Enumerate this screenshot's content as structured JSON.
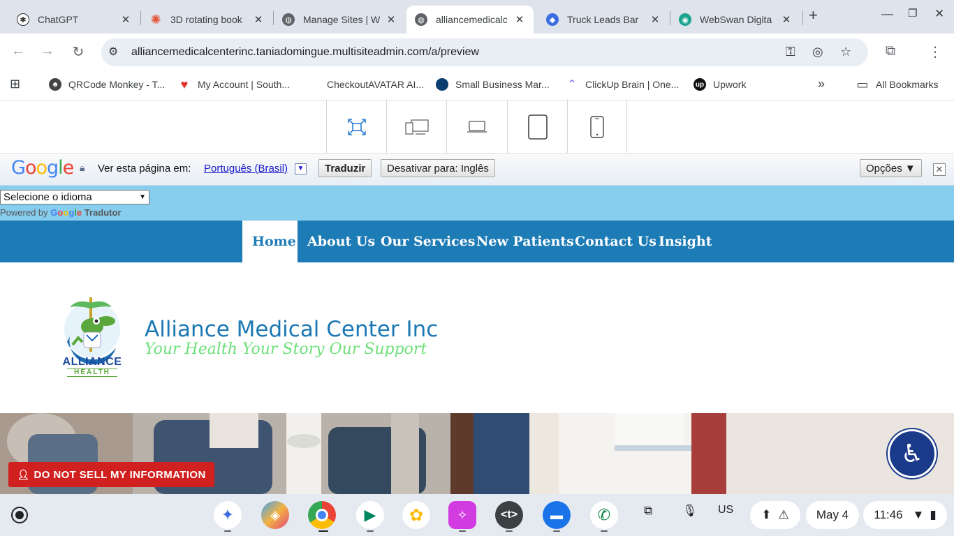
{
  "browser": {
    "tabs": [
      {
        "label": "ChatGPT",
        "icon": "chatgpt-icon"
      },
      {
        "label": "3D rotating book",
        "icon": "sparkle-icon"
      },
      {
        "label": "Manage Sites | W",
        "icon": "globe-icon"
      },
      {
        "label": "alliancemedicalc",
        "icon": "globe-icon",
        "active": true
      },
      {
        "label": "Truck Leads Bar",
        "icon": "dialog-icon"
      },
      {
        "label": "WebSwan Digita",
        "icon": "webswan-icon"
      }
    ],
    "new_tab": "+",
    "url": "alliancemedicalcenterinc.taniadomingue.multisiteadmin.com/a/preview",
    "bookmarks": [
      {
        "label": "QRCode Monkey - T...",
        "icon": "monkey-icon"
      },
      {
        "label": "My Account | South...",
        "icon": "heart-icon"
      },
      {
        "label": "CheckoutAVATAR AI...",
        "icon": "apple-icon"
      },
      {
        "label": "Small Business Mar...",
        "icon": "circle-icon"
      },
      {
        "label": "ClickUp Brain | One...",
        "icon": "clickup-icon"
      },
      {
        "label": "Upwork",
        "icon": "upwork-icon"
      }
    ],
    "bookmarks_overflow": "»",
    "all_bookmarks": "All Bookmarks"
  },
  "translate_bar": {
    "brand": "Google",
    "prompt": "Ver esta página em:",
    "language_link": "Português (Brasil)",
    "language_arrow": "▼",
    "translate_button": "Traduzir",
    "disable_button": "Desativar para: Inglês",
    "options_button": "Opções ▼",
    "close": "✕"
  },
  "page": {
    "language_select": "Selecione o idioma",
    "powered_by": "Powered by",
    "powered_google": "Google",
    "powered_tradutor": "Tradutor",
    "nav": [
      "Home",
      "About Us",
      "Our Services",
      "New Patients",
      "Contact Us",
      "Insight"
    ],
    "logo_text": "ALLIANCE",
    "logo_sub": "HEALTH",
    "site_title": "Alliance Medical Center Inc",
    "tagline": "Your Health Your Story Our Support",
    "do_not_sell": "DO NOT SELL MY INFORMATION"
  },
  "shelf": {
    "apps": [
      "gemini",
      "copilot",
      "chrome",
      "play-store",
      "photos",
      "notes",
      "terminal",
      "files",
      "phone"
    ],
    "terminal_glyph": "<t>",
    "keyboard": "US",
    "date": "May 4",
    "time": "11:46"
  },
  "colors": {
    "nav_blue": "#1d7bb5",
    "lang_strip": "#87cdee",
    "tagline_green": "#6ee07a",
    "dns_red": "#d0201f"
  }
}
